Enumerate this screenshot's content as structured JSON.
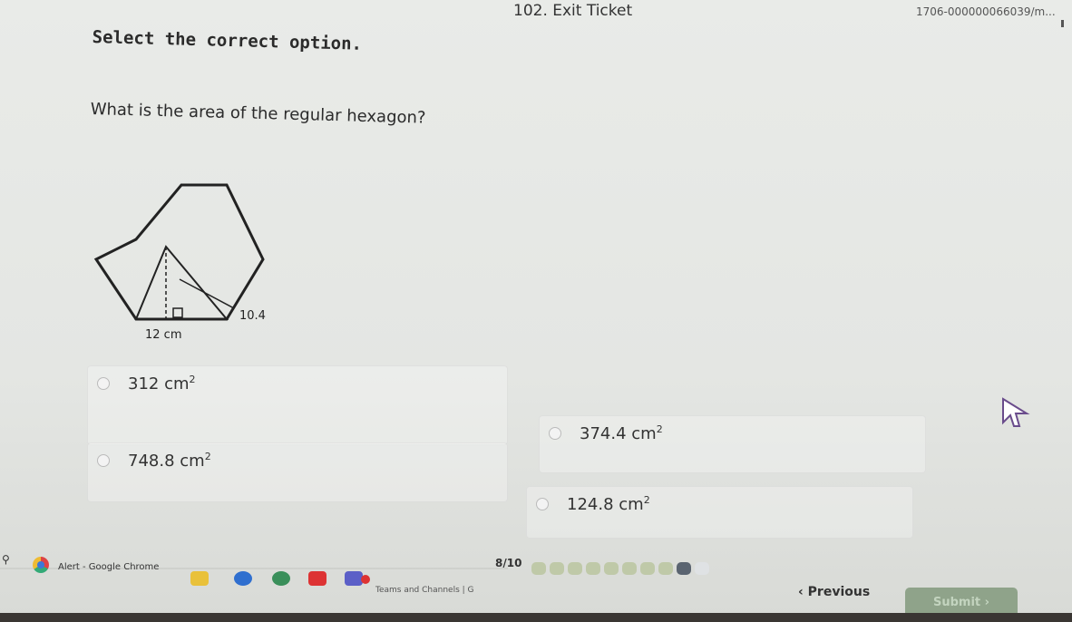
{
  "header": {
    "title": "102. Exit Ticket",
    "url_fragment": "1706-000000066039/m..."
  },
  "question": {
    "instruction": "Select the correct option.",
    "prompt": "What is the area of the regular hexagon?",
    "figure": {
      "side_label": "12 cm",
      "apothem_label": "10.4"
    },
    "options": [
      {
        "value": "312",
        "unit": "cm",
        "exp": "2"
      },
      {
        "value": "374.4",
        "unit": "cm",
        "exp": "2"
      },
      {
        "value": "748.8",
        "unit": "cm",
        "exp": "2"
      },
      {
        "value": "124.8",
        "unit": "cm",
        "exp": "2"
      }
    ]
  },
  "progress": {
    "label": "8/10",
    "completed": 8,
    "current": 9,
    "total": 10
  },
  "nav": {
    "previous_label": "Previous",
    "submit_label": "Submit"
  },
  "taskbar": {
    "alert_text": "Alert - Google Chrome",
    "teams_text": "Teams and Channels | G"
  }
}
